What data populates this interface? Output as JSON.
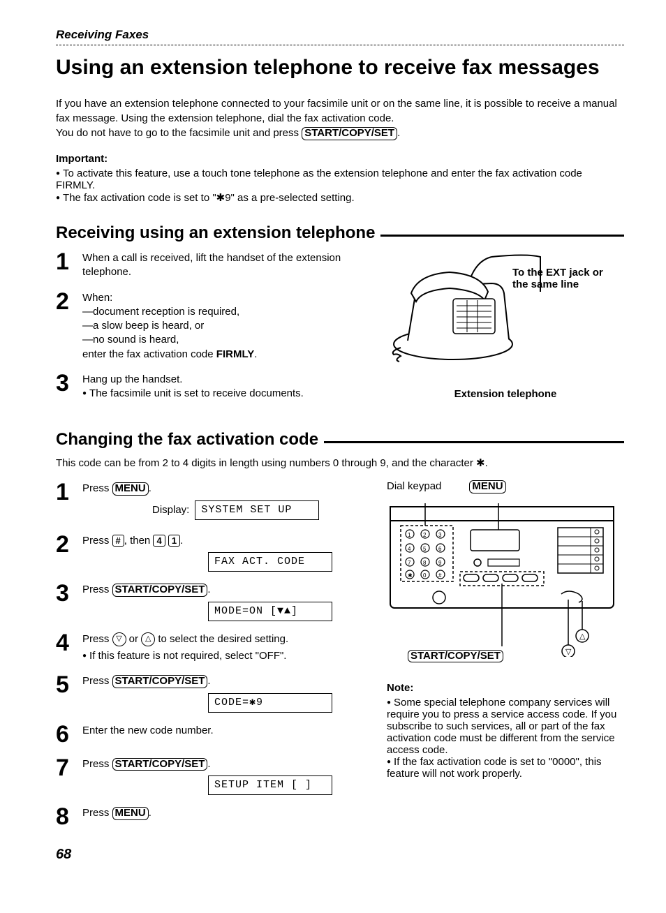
{
  "section_label": "Receiving Faxes",
  "title": "Using an extension telephone to receive fax messages",
  "intro_p1": "If you have an extension telephone connected to your facsimile unit or on the same line, it is possible to receive a manual fax message. Using the extension telephone, dial the fax activation code.",
  "intro_p2_a": "You do not have to go to the facsimile unit and press ",
  "btn_start": "START/COPY/SET",
  "important_hd": "Important:",
  "important_b1": "To activate this feature, use a touch tone telephone as the extension telephone and enter the fax activation code FIRMLY.",
  "important_b2": "The fax activation code is set to \"✱9\" as a pre-selected setting.",
  "h2_receiving": "Receiving using an extension telephone",
  "recv_steps": {
    "s1": "When a call is received, lift the handset of the extension telephone.",
    "s2_when": "When:",
    "s2_a": "document reception is required,",
    "s2_b": "a slow beep is heard, or",
    "s2_c": "no sound is heard,",
    "s2_end_a": "enter the fax activation code ",
    "s2_end_b": "FIRMLY",
    "s3_a": "Hang up the handset.",
    "s3_b": "The facsimile unit is set to receive documents."
  },
  "fig1_label": "To the EXT jack or the same line",
  "fig1_caption": "Extension telephone",
  "h2_changing": "Changing the fax activation code",
  "changing_intro": "This code can be from 2 to 4 digits in length using numbers 0 through 9, and the character ✱.",
  "chg_steps": {
    "s1_a": "Press ",
    "btn_menu": "MENU",
    "display_label": "Display:",
    "lcd1": "SYSTEM SET UP",
    "s2_a": "Press ",
    "key_hash": "#",
    "s2_b": ", then ",
    "key_4": "4",
    "key_1": "1",
    "lcd2": "FAX ACT. CODE",
    "s3_a": "Press ",
    "lcd3": "MODE=ON    [▼▲]",
    "s4_a": "Press ",
    "s4_b": " or ",
    "s4_c": " to select the desired setting.",
    "s4_note": "If this feature is not required, select \"OFF\".",
    "s5_a": "Press ",
    "lcd5": "CODE=✱9",
    "s6": "Enter the new code number.",
    "s7_a": "Press ",
    "lcd7": "SETUP ITEM [  ]",
    "s8_a": "Press "
  },
  "fig2": {
    "dial_keypad": "Dial keypad",
    "menu": "MENU",
    "start": "START/COPY/SET"
  },
  "note_hd": "Note:",
  "note_b1": "Some special telephone company services will require you to press a service access code. If you subscribe to such services, all or part of the fax activation code must be different from the service access code.",
  "note_b2": "If the fax activation code is set to \"0000\", this feature will not work properly.",
  "page_num": "68"
}
